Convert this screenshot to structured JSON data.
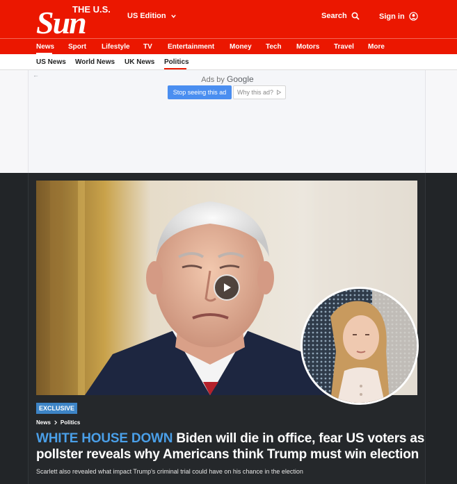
{
  "header": {
    "logo_small": "THE U.S.",
    "logo_big": "Sun",
    "edition": "US Edition",
    "search": "Search",
    "signin": "Sign in"
  },
  "nav": {
    "items": [
      "News",
      "Sport",
      "Lifestyle",
      "TV",
      "Entertainment",
      "Money",
      "Tech",
      "Motors",
      "Travel",
      "More"
    ],
    "active": "News"
  },
  "subnav": {
    "items": [
      "US News",
      "World News",
      "UK News",
      "Politics"
    ],
    "active": "Politics"
  },
  "ad": {
    "ads_by": "Ads by",
    "google": "Google",
    "stop": "Stop seeing this ad",
    "why": "Why this ad?"
  },
  "article": {
    "badge": "EXCLUSIVE",
    "crumb_1": "News",
    "crumb_2": "Politics",
    "kicker": "WHITE HOUSE DOWN",
    "headline": "Biden will die in office, fear US voters as pollster reveals why Americans think Trump must win election",
    "standfirst": "Scarlett also revealed what impact Trump's criminal trial could have on his chance in the election"
  },
  "colors": {
    "brand_red": "#eb1700",
    "accent_blue": "#3d84c6",
    "dark_bg": "#222528"
  }
}
